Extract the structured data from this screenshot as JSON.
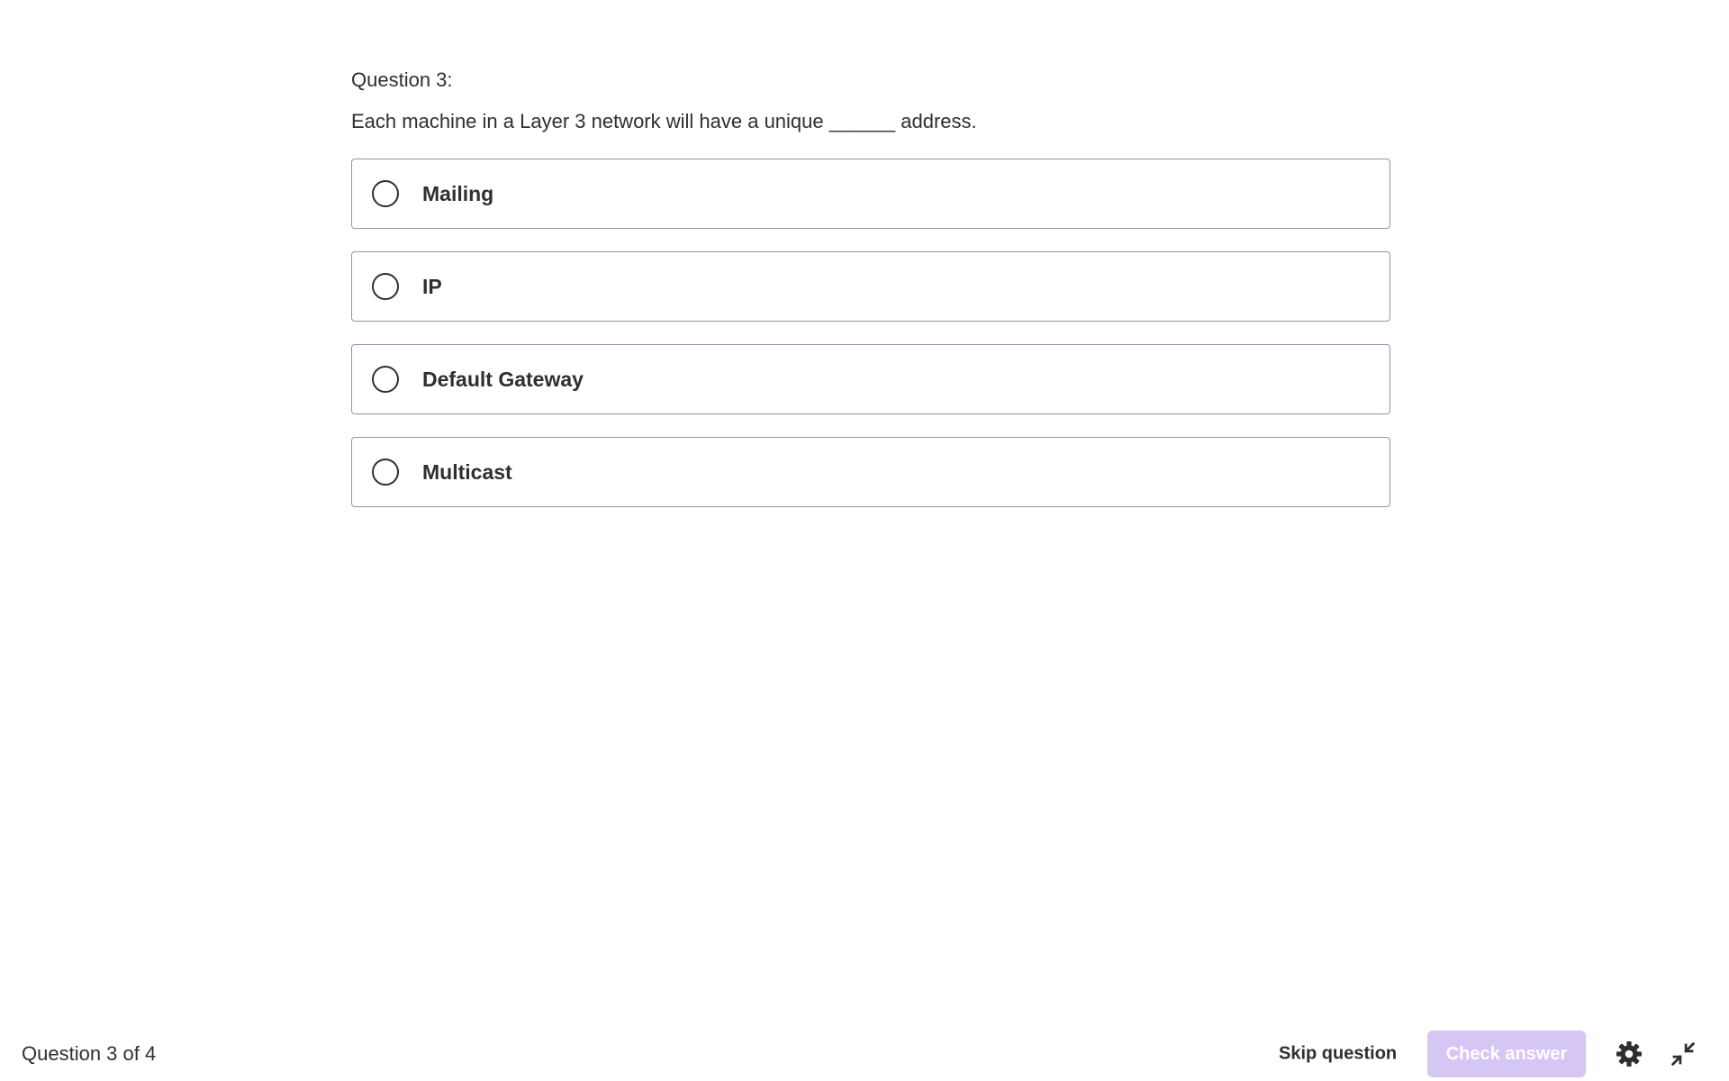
{
  "question": {
    "number_label": "Question 3:",
    "prompt": "Each machine in a Layer 3 network will have a unique ______ address."
  },
  "answers": [
    {
      "label": "Mailing"
    },
    {
      "label": "IP"
    },
    {
      "label": "Default Gateway"
    },
    {
      "label": "Multicast"
    }
  ],
  "footer": {
    "progress": "Question 3 of 4",
    "skip_label": "Skip question",
    "check_label": "Check answer",
    "settings_icon": "gear-icon",
    "collapse_icon": "collapse-icon"
  },
  "colors": {
    "text": "#2d2f31",
    "border": "#9194ac",
    "check_disabled_bg": "#d5c6f4"
  }
}
